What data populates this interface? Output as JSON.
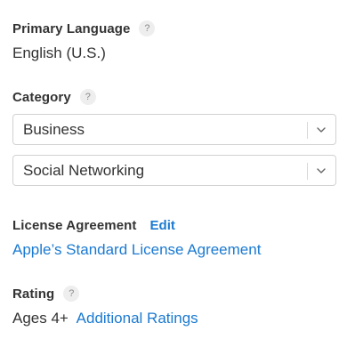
{
  "primary_language": {
    "label": "Primary Language",
    "help": "?",
    "value": "English (U.S.)"
  },
  "category": {
    "label": "Category",
    "help": "?",
    "primary_select": "Business",
    "secondary_select": "Social Networking"
  },
  "license_agreement": {
    "label": "License Agreement",
    "edit_label": "Edit",
    "link_text": "Apple’s Standard License Agreement"
  },
  "rating": {
    "label": "Rating",
    "help": "?",
    "value": "Ages 4+",
    "additional_link": "Additional Ratings"
  },
  "colors": {
    "link": "#1b7ad1",
    "text": "#333333",
    "border": "#d2d2d2"
  }
}
